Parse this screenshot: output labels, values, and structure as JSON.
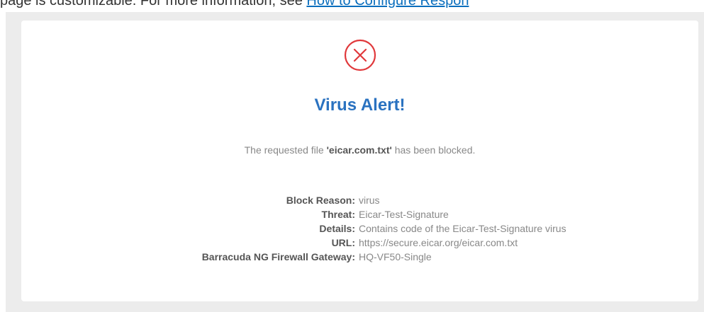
{
  "header_text": {
    "prefix": "page is customizable. For more information, see ",
    "link": "How to Configure Respon"
  },
  "alert": {
    "icon": "error-x-circle-icon",
    "icon_color": "#e0383b",
    "title": "Virus Alert!",
    "title_color": "#2a72c0",
    "message_prefix": "The requested file ",
    "file_name": "'eicar.com.txt'",
    "message_suffix": " has been blocked."
  },
  "details": [
    {
      "label": "Block Reason:",
      "value": "virus"
    },
    {
      "label": "Threat:",
      "value": "Eicar-Test-Signature"
    },
    {
      "label": "Details:",
      "value": "Contains code of the Eicar-Test-Signature virus"
    },
    {
      "label": "URL:",
      "value": "https://secure.eicar.org/eicar.com.txt"
    },
    {
      "label": "Barracuda NG Firewall Gateway:",
      "value": "HQ-VF50-Single"
    }
  ]
}
